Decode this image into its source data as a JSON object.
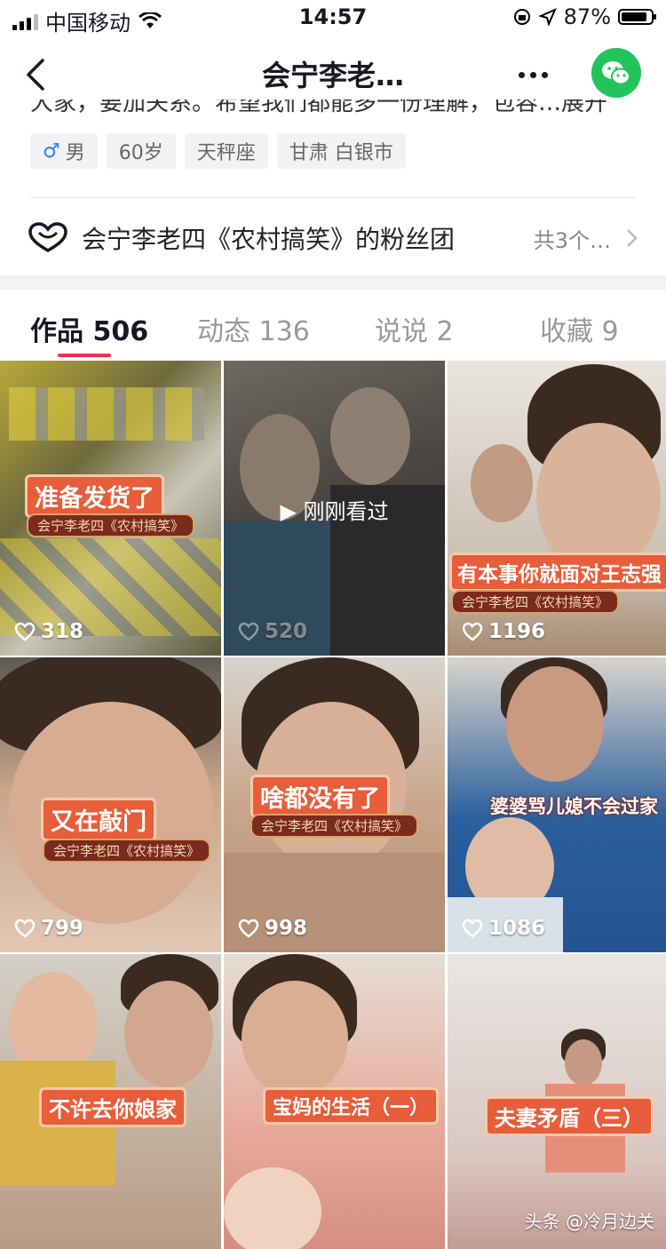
{
  "status_bar": {
    "carrier": "中国移动",
    "time": "14:57",
    "battery": "87%",
    "battery_level": 0.87
  },
  "nav": {
    "title": "会宁李老…"
  },
  "profile": {
    "bio_cut": "大家，要加关系。希望我们都能多一份理解，包容…展开",
    "gender_label": "男",
    "age": "60岁",
    "zodiac": "天秤座",
    "location": "甘肃 白银市",
    "fan_group": "会宁李老四《农村搞笑》的粉丝团",
    "fan_group_count": "共3个…"
  },
  "tabs": [
    {
      "label": "作品 506"
    },
    {
      "label": "动态 136"
    },
    {
      "label": "说说 2"
    },
    {
      "label": "收藏 9"
    }
  ],
  "videos": [
    {
      "caption": "准备发货了",
      "subcaption": "会宁李老四《农村搞笑》",
      "likes": "318"
    },
    {
      "caption": "",
      "watched": "刚刚看过",
      "likes": "520"
    },
    {
      "caption": "有本事你就面对王志强",
      "subcaption": "会宁李老四《农村搞笑》",
      "likes": "1196"
    },
    {
      "caption": "又在敲门",
      "subcaption": "会宁李老四《农村搞笑》",
      "likes": "799"
    },
    {
      "caption": "啥都没有了",
      "subcaption": "会宁李老四《农村搞笑》",
      "likes": "998"
    },
    {
      "caption": "婆婆骂儿媳不会过家",
      "likes": "1086"
    },
    {
      "caption": "不许去你娘家"
    },
    {
      "caption": "宝妈的生活（一）"
    },
    {
      "caption": "夫妻矛盾（三）"
    }
  ],
  "watermark": "头条 @冷月边关",
  "colors": {
    "accent": "#fe2c55",
    "wechat": "#21c45a",
    "caption_bg": "#e85d3a",
    "male": "#2c7ef8"
  }
}
